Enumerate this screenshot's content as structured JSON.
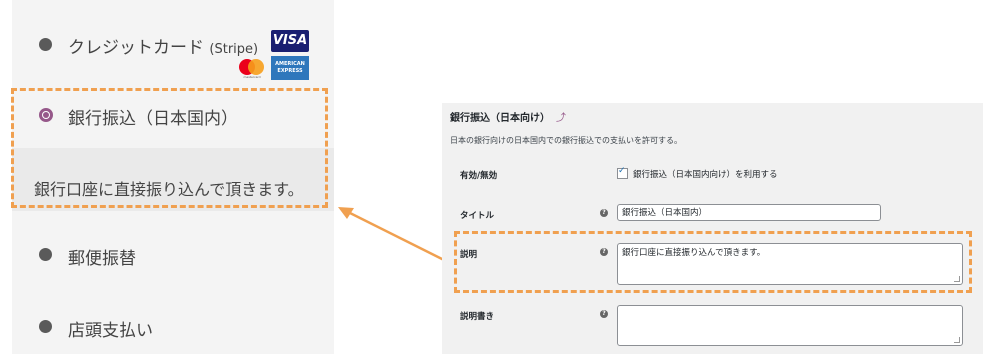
{
  "checkout": {
    "methods": [
      {
        "label": "クレジットカード",
        "suffix": "(Stripe)"
      },
      {
        "label": "銀行振込（日本国内）",
        "description": "銀行口座に直接振り込んで頂きます。"
      },
      {
        "label": "郵便振替"
      },
      {
        "label": "店頭支払い"
      }
    ],
    "card_logos": {
      "visa": "VISA",
      "mastercard": "mastercard",
      "amex_line1": "AMERICAN",
      "amex_line2": "EXPRESS"
    },
    "selected_index": 1,
    "accent_color": "#96588a"
  },
  "admin": {
    "heading": "銀行振込（日本向け）",
    "heading_icon": "⤴",
    "subtitle": "日本の銀行向けの日本国内での銀行振込での支払いを許可する。",
    "fields": {
      "enable_label": "有効/無効",
      "enable_checkbox_label": "銀行振込（日本国内向け）を利用する",
      "enable_checked": true,
      "title_label": "タイトル",
      "title_value": "銀行振込（日本国内）",
      "description_label": "説明",
      "description_value": "銀行口座に直接振り込んで頂きます。",
      "instructions_label": "説明書き",
      "instructions_value": ""
    },
    "help_glyph": "?"
  },
  "colors": {
    "highlight": "#f0a050",
    "arrow": "#f0a050"
  }
}
